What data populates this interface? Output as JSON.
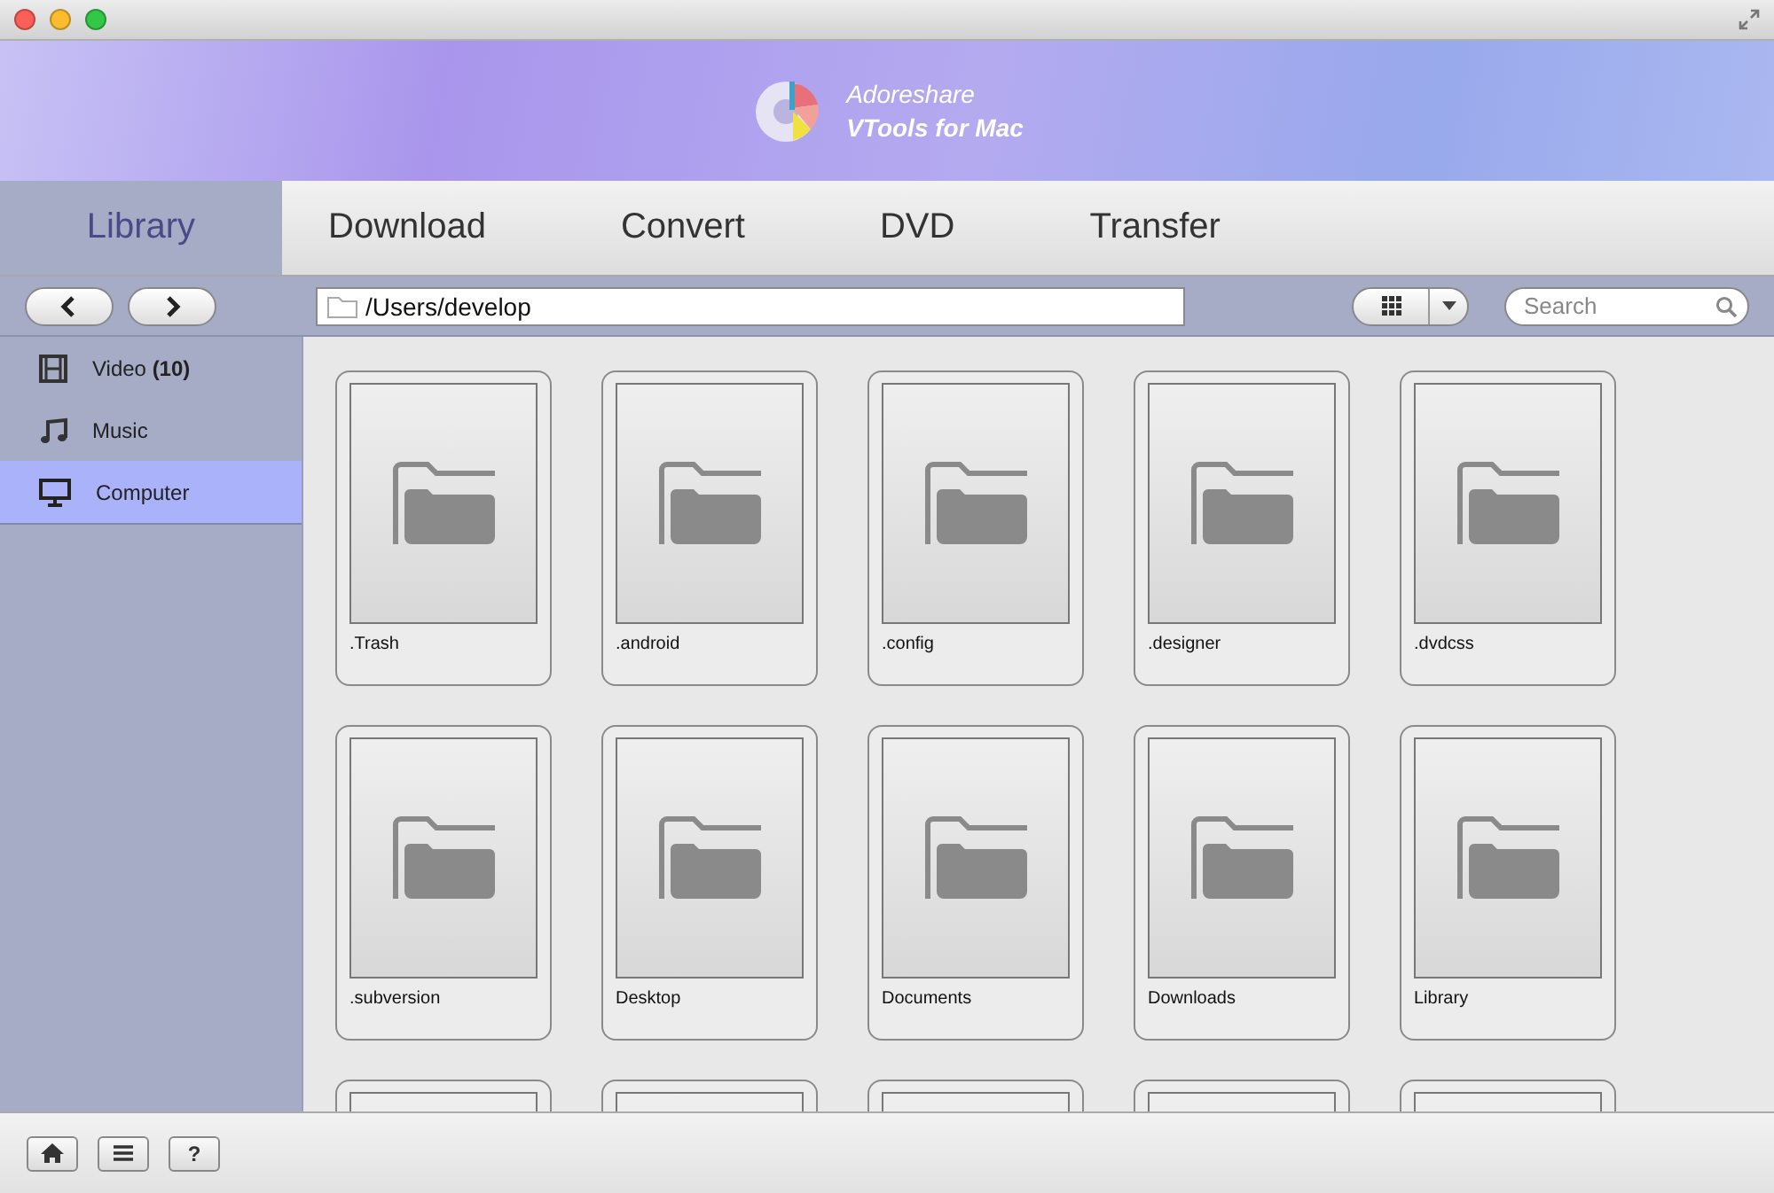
{
  "header": {
    "brand": "Adoreshare",
    "product": "VTools for Mac"
  },
  "tabs": [
    {
      "label": "Library",
      "selected": true
    },
    {
      "label": "Download",
      "selected": false
    },
    {
      "label": "Convert",
      "selected": false
    },
    {
      "label": "DVD",
      "selected": false
    },
    {
      "label": "Transfer",
      "selected": false
    }
  ],
  "toolbar": {
    "path": "/Users/develop",
    "search": {
      "placeholder": "Search"
    }
  },
  "sidebar": {
    "items": [
      {
        "label": "Video **(10)**",
        "kind": "video",
        "selected": false
      },
      {
        "label": "Music",
        "kind": "music",
        "selected": false
      },
      {
        "label": "Computer",
        "kind": "computer",
        "selected": true
      }
    ]
  },
  "folders": [
    {
      "kind": "folder",
      "name": ".Trash"
    },
    {
      "kind": "folder",
      "name": ".android"
    },
    {
      "kind": "folder",
      "name": ".config"
    },
    {
      "kind": "folder",
      "name": ".designer"
    },
    {
      "kind": "folder",
      "name": ".dvdcss"
    },
    {
      "kind": "folder",
      "name": ".subversion"
    },
    {
      "kind": "folder",
      "name": "Desktop"
    },
    {
      "kind": "folder",
      "name": "Documents"
    },
    {
      "kind": "folder",
      "name": "Downloads"
    },
    {
      "kind": "folder",
      "name": "Library"
    },
    {
      "kind": "folder"
    },
    {
      "kind": "folder"
    },
    {
      "kind": "folder"
    },
    {
      "kind": "folder"
    },
    {
      "kind": "folder"
    }
  ],
  "footer": {
    "help": "?"
  }
}
